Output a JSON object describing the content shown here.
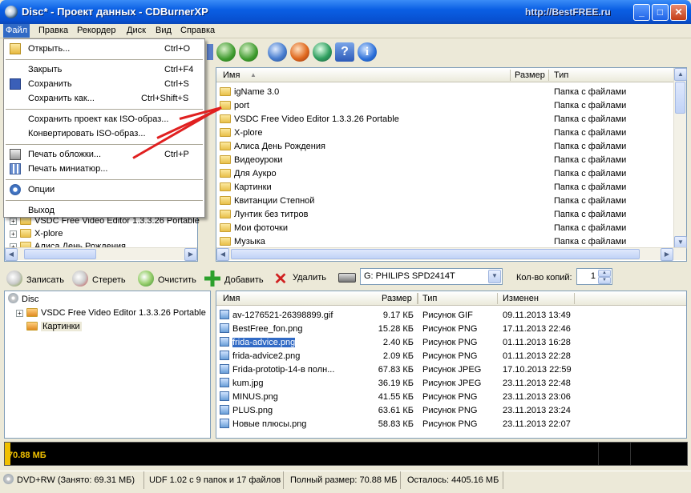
{
  "window": {
    "title": "Disc* - Проект данных - CDBurnerXP",
    "watermark": "http://BestFREE.ru"
  },
  "menubar": [
    "Файл",
    "Правка",
    "Рекордер",
    "Диск",
    "Вид",
    "Справка"
  ],
  "file_menu": [
    {
      "label": "Открыть...",
      "shortcut": "Ctrl+O",
      "icon": "folder-open-icon"
    },
    {
      "label": "Закрыть",
      "shortcut": "Ctrl+F4"
    },
    {
      "label": "Сохранить",
      "shortcut": "Ctrl+S",
      "icon": "floppy-icon"
    },
    {
      "label": "Сохранить как...",
      "shortcut": "Ctrl+Shift+S"
    },
    {
      "label": "Сохранить проект как ISO-образ..."
    },
    {
      "label": "Конвертировать ISO-образ..."
    },
    {
      "label": "Печать обложки...",
      "shortcut": "Ctrl+P",
      "icon": "printer-icon"
    },
    {
      "label": "Печать миниатюр...",
      "icon": "thumbnails-icon"
    },
    {
      "label": "Опции",
      "icon": "gear-icon"
    },
    {
      "label": "Выход"
    }
  ],
  "top_tree": {
    "items": [
      "VSDC Free Video Editor 1.3.3.26 Portable",
      "X-plore",
      "Алиса День Рождения"
    ]
  },
  "top_list": {
    "columns": [
      "Имя",
      "Размер",
      "Тип"
    ],
    "rows": [
      {
        "name": "igName 3.0",
        "type": "Папка с файлами"
      },
      {
        "name": "port",
        "type": "Папка с файлами"
      },
      {
        "name": "VSDC Free Video Editor 1.3.3.26 Portable",
        "type": "Папка с файлами"
      },
      {
        "name": "X-plore",
        "type": "Папка с файлами"
      },
      {
        "name": "Алиса День Рождения",
        "type": "Папка с файлами"
      },
      {
        "name": "Видеоуроки",
        "type": "Папка с файлами"
      },
      {
        "name": "Для Аукро",
        "type": "Папка с файлами"
      },
      {
        "name": "Картинки",
        "type": "Папка с файлами"
      },
      {
        "name": "Квитанции Степной",
        "type": "Папка с файлами"
      },
      {
        "name": "Лунтик без титров",
        "type": "Папка с файлами"
      },
      {
        "name": "Мои фоточки",
        "type": "Папка с файлами"
      },
      {
        "name": "Музыка",
        "type": "Папка с файлами"
      }
    ]
  },
  "toolbar2": {
    "burn": "Записать",
    "erase": "Стереть",
    "clear": "Очистить",
    "add": "Добавить",
    "delete": "Удалить",
    "drive": "G: PHILIPS SPD2414T",
    "copies_label": "Кол-во копий:",
    "copies": "1"
  },
  "disc_tree": {
    "root": "Disc",
    "items": [
      "VSDC Free Video Editor 1.3.3.26 Portable",
      "Картинки"
    ]
  },
  "disc_list": {
    "columns": [
      "Имя",
      "Размер",
      "Тип",
      "Изменен"
    ],
    "rows": [
      {
        "name": "av-1276521-26398899.gif",
        "size": "9.17 КБ",
        "type": "Рисунок GIF",
        "date": "09.11.2013 13:49"
      },
      {
        "name": "BestFree_fon.png",
        "size": "15.28 КБ",
        "type": "Рисунок PNG",
        "date": "17.11.2013 22:46"
      },
      {
        "name": "frida-advice.png",
        "size": "2.40 КБ",
        "type": "Рисунок PNG",
        "date": "01.11.2013 16:28"
      },
      {
        "name": "frida-advice2.png",
        "size": "2.09 КБ",
        "type": "Рисунок PNG",
        "date": "01.11.2013 22:28"
      },
      {
        "name": "Frida-prototip-14-в полн...",
        "size": "67.83 КБ",
        "type": "Рисунок JPEG",
        "date": "17.10.2013 22:59"
      },
      {
        "name": "kum.jpg",
        "size": "36.19 КБ",
        "type": "Рисунок JPEG",
        "date": "23.11.2013 22:48"
      },
      {
        "name": "MINUS.png",
        "size": "41.55 КБ",
        "type": "Рисунок PNG",
        "date": "23.11.2013 23:06"
      },
      {
        "name": "PLUS.png",
        "size": "63.61 КБ",
        "type": "Рисунок PNG",
        "date": "23.11.2013 23:24"
      },
      {
        "name": "Новые плюсы.png",
        "size": "58.83 КБ",
        "type": "Рисунок PNG",
        "date": "23.11.2013 22:07"
      }
    ]
  },
  "capacity": {
    "used_label": "70.88 МБ"
  },
  "status": [
    "DVD+RW (Занято: 69.31 МБ)",
    "UDF 1.02 с 9 папок и 17 файлов",
    "Полный размер: 70.88 МБ",
    "Осталось: 4405.16 МБ"
  ],
  "colors": {
    "accent": "#316ac5",
    "arrow": "#e02020",
    "bar": "#f0c000"
  }
}
